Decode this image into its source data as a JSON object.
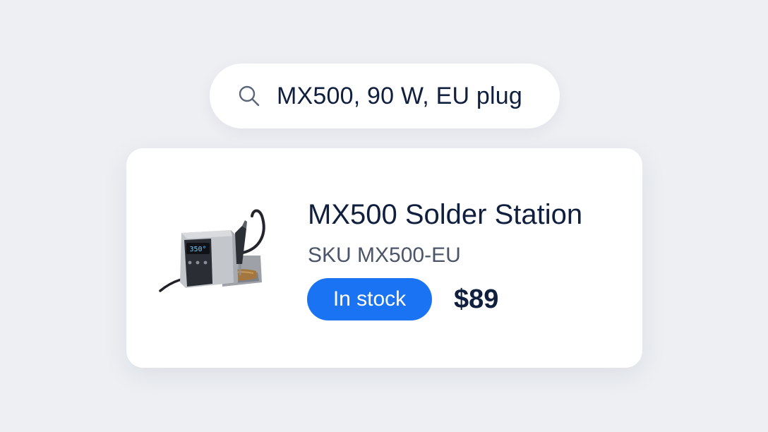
{
  "search": {
    "query": "MX500, 90 W, EU plug",
    "icon": "search-icon"
  },
  "product": {
    "title": "MX500 Solder Station",
    "sku": "SKU MX500-EU",
    "display_readout": "350°",
    "stock_label": "In stock",
    "price": "$89",
    "image_icon": "solder-station-image"
  },
  "colors": {
    "background": "#edeff3",
    "accent": "#1a73f2",
    "text_primary": "#0f1f3d",
    "text_secondary": "#4b5468"
  }
}
